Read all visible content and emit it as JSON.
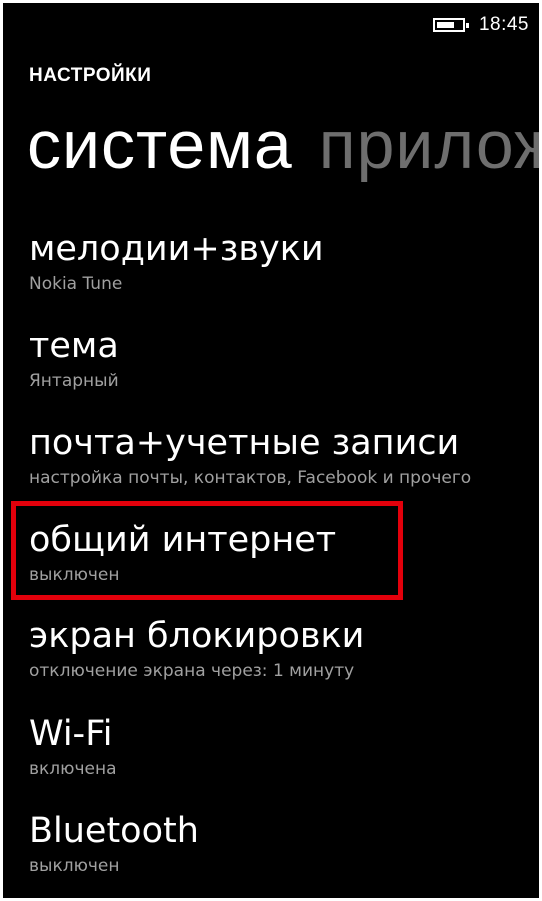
{
  "status_bar": {
    "time": "18:45",
    "battery_level": 0.7,
    "battery_icon": "battery-icon"
  },
  "app_title": "НАСТРОЙКИ",
  "pivot": {
    "active": "система",
    "next": "прилож"
  },
  "items": [
    {
      "title": "мелодии+звуки",
      "subtitle": "Nokia Tune"
    },
    {
      "title": "тема",
      "subtitle": "Янтарный"
    },
    {
      "title": "почта+учетные записи",
      "subtitle": "настройка почты, контактов, Facebook и прочего"
    },
    {
      "title": "общий интернет",
      "subtitle": "выключен"
    },
    {
      "title": "экран блокировки",
      "subtitle": "отключение экрана через: 1 минуту"
    },
    {
      "title": "Wi-Fi",
      "subtitle": "включена"
    },
    {
      "title": "Bluetooth",
      "subtitle": "выключен"
    }
  ],
  "colors": {
    "background": "#000000",
    "text": "#ffffff",
    "subtext": "#a0a0a0",
    "pivot_inactive": "#6e6e6e",
    "highlight": "#e3000b"
  }
}
